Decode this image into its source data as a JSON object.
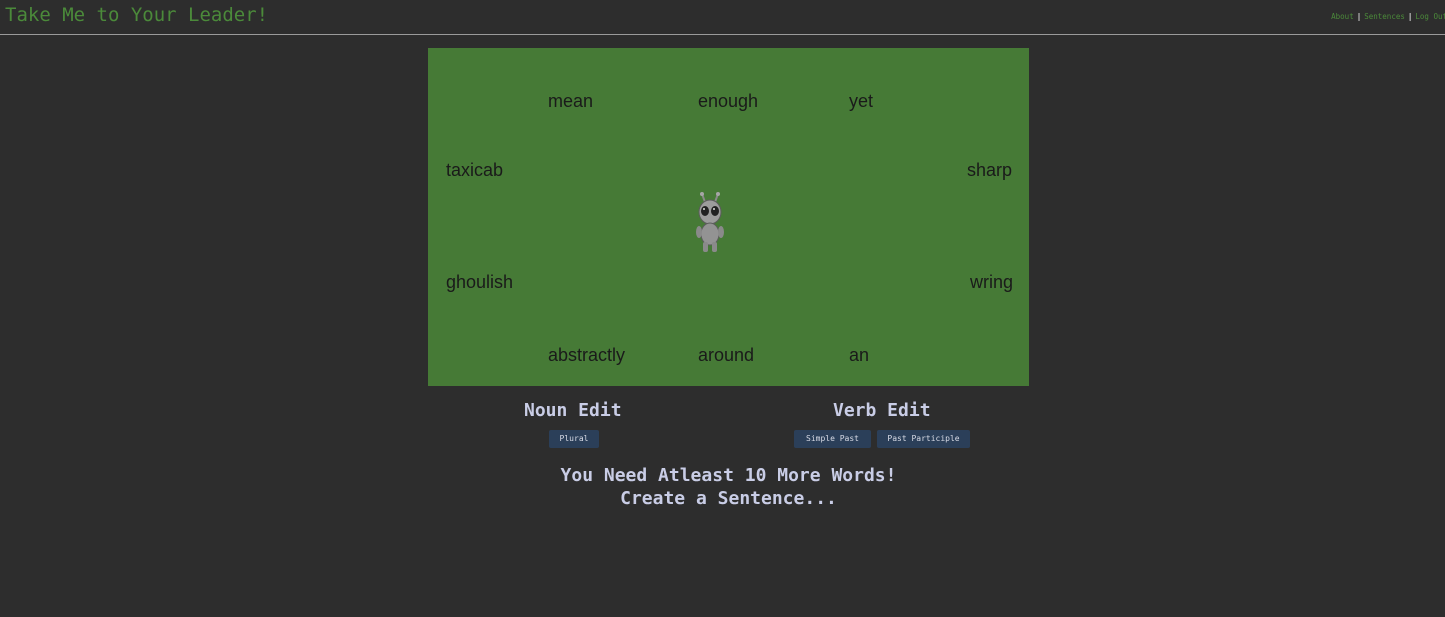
{
  "header": {
    "title": "Take Me to Your Leader!",
    "nav": [
      {
        "label": "About"
      },
      {
        "label": "Sentences"
      },
      {
        "label": "Log Out"
      }
    ]
  },
  "game": {
    "words": {
      "mean": "mean",
      "enough": "enough",
      "yet": "yet",
      "taxicab": "taxicab",
      "sharp": "sharp",
      "ghoulish": "ghoulish",
      "wring": "wring",
      "abstractly": "abstractly",
      "around": "around",
      "an": "an"
    },
    "player_icon": "alien-icon"
  },
  "noun_edit": {
    "title": "Noun Edit",
    "buttons": {
      "plural": "Plural"
    }
  },
  "verb_edit": {
    "title": "Verb Edit",
    "buttons": {
      "simple_past": "Simple Past",
      "past_participle": "Past Participle"
    }
  },
  "message": {
    "line1": "You Need Atleast 10 More Words!",
    "line2": "Create a Sentence..."
  },
  "colors": {
    "background": "#2d2d2d",
    "accent": "#4b8a3a",
    "game_field": "#467a36",
    "button": "#2b3f59",
    "heading": "#c9cde6"
  }
}
